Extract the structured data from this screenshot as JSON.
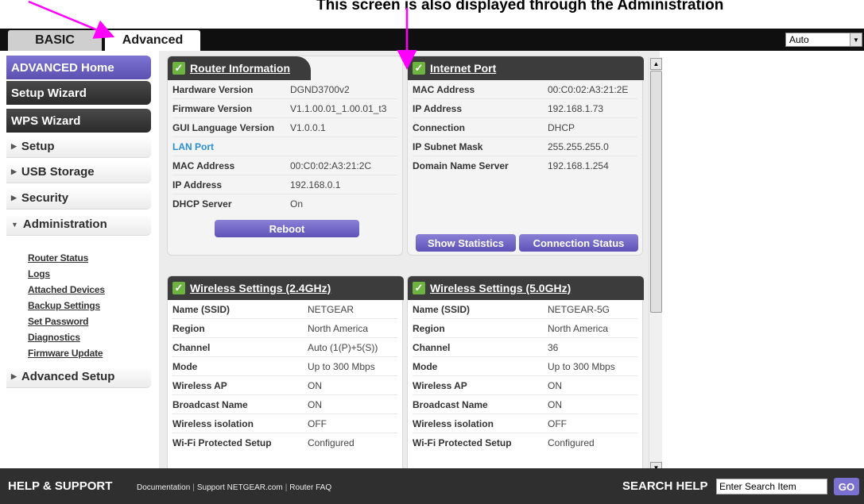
{
  "annotation": {
    "caption": "This screen is also displayed through the Administration"
  },
  "tabs": {
    "basic": "BASIC",
    "advanced": "Advanced"
  },
  "language_select": {
    "value": "Auto"
  },
  "sidebar": {
    "home": "ADVANCED Home",
    "setup_wizard": "Setup Wizard",
    "wps_wizard": "WPS Wizard",
    "setup": "Setup",
    "usb_storage": "USB Storage",
    "security": "Security",
    "administration": "Administration",
    "admin_items": [
      "Router Status",
      "Logs",
      "Attached Devices",
      "Backup Settings",
      "Set Password",
      "Diagnostics",
      "Firmware Update"
    ],
    "advanced_setup": "Advanced Setup"
  },
  "router_info": {
    "title": "Router Information",
    "rows": [
      {
        "k": "Hardware Version",
        "v": "DGND3700v2"
      },
      {
        "k": "Firmware Version",
        "v": "V1.1.00.01_1.00.01_t3"
      },
      {
        "k": "GUI Language Version",
        "v": "V1.0.0.1"
      }
    ],
    "lan_port_label": "LAN Port",
    "lan_rows": [
      {
        "k": "MAC Address",
        "v": "00:C0:02:A3:21:2C"
      },
      {
        "k": "IP Address",
        "v": "192.168.0.1"
      },
      {
        "k": "DHCP Server",
        "v": "On"
      }
    ],
    "reboot_label": "Reboot"
  },
  "internet_port": {
    "title": "Internet Port",
    "rows": [
      {
        "k": "MAC Address",
        "v": "00:C0:02:A3:21:2E"
      },
      {
        "k": "IP Address",
        "v": "192.168.1.73"
      },
      {
        "k": "Connection",
        "v": "DHCP"
      },
      {
        "k": "IP Subnet Mask",
        "v": "255.255.255.0"
      },
      {
        "k": "Domain Name Server",
        "v": "192.168.1.254"
      }
    ],
    "show_statistics": "Show Statistics",
    "connection_status": "Connection Status"
  },
  "wireless_24": {
    "title": "Wireless Settings (2.4GHz)",
    "rows": [
      {
        "k": "Name (SSID)",
        "v": "NETGEAR"
      },
      {
        "k": "Region",
        "v": "North America"
      },
      {
        "k": "Channel",
        "v": "Auto (1(P)+5(S))"
      },
      {
        "k": "Mode",
        "v": "Up to 300 Mbps"
      },
      {
        "k": "Wireless AP",
        "v": "ON"
      },
      {
        "k": "Broadcast Name",
        "v": "ON"
      },
      {
        "k": "Wireless isolation",
        "v": "OFF"
      },
      {
        "k": "Wi-Fi Protected Setup",
        "v": "Configured"
      }
    ]
  },
  "wireless_5": {
    "title": "Wireless Settings (5.0GHz)",
    "rows": [
      {
        "k": "Name (SSID)",
        "v": "NETGEAR-5G"
      },
      {
        "k": "Region",
        "v": "North America"
      },
      {
        "k": "Channel",
        "v": "36"
      },
      {
        "k": "Mode",
        "v": "Up to 300 Mbps"
      },
      {
        "k": "Wireless AP",
        "v": "ON"
      },
      {
        "k": "Broadcast Name",
        "v": "ON"
      },
      {
        "k": "Wireless isolation",
        "v": "OFF"
      },
      {
        "k": "Wi-Fi Protected Setup",
        "v": "Configured"
      }
    ]
  },
  "footer": {
    "help_support": "HELP & SUPPORT",
    "links": [
      "Documentation",
      "Support NETGEAR.com",
      "Router FAQ"
    ],
    "search_help": "SEARCH HELP",
    "search_value": "Enter Search Item",
    "go": "GO"
  },
  "colors": {
    "accent_purple": "#6f64c8",
    "check_green": "#6db33f",
    "annotation_arrow": "#ff00ff",
    "lan_port_blue": "#2a8fd0"
  }
}
